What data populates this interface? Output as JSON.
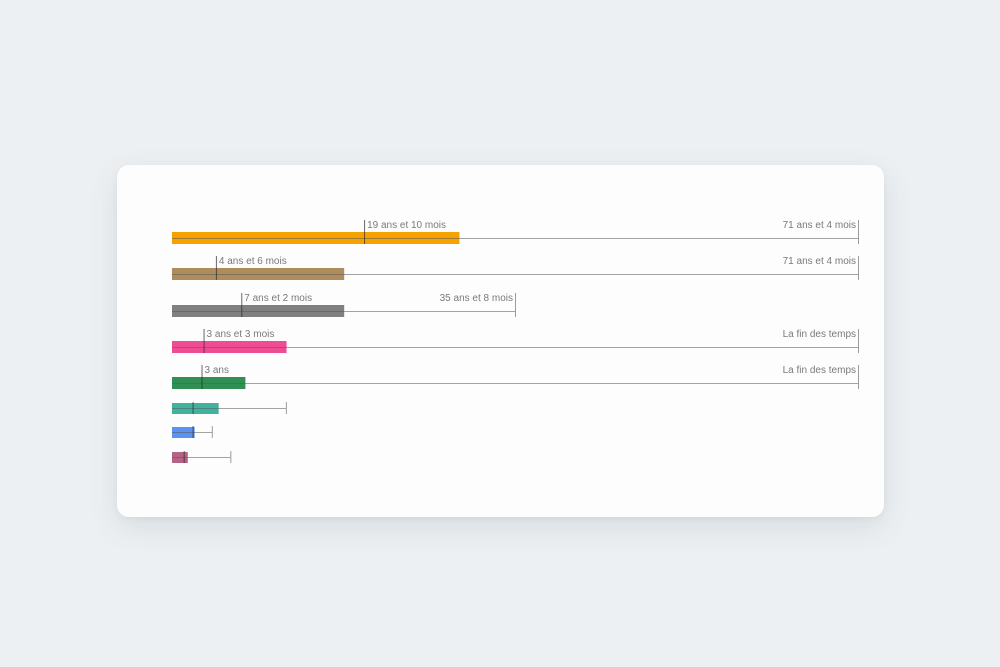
{
  "chart_data": {
    "type": "bar",
    "scale_max": 2000,
    "rows": [
      {
        "bar_value": 419,
        "bar_color": "#f5a100",
        "tick_value": 280,
        "tick_label": "19 ans et 10 mois",
        "range_end": 1000,
        "end_label": "71 ans et 4 mois"
      },
      {
        "bar_value": 251,
        "bar_color": "#ae8c5c",
        "tick_value": 64,
        "tick_label": "4 ans et 6 mois",
        "range_end": 1000,
        "end_label": "71 ans et 4 mois"
      },
      {
        "bar_value": 251,
        "bar_color": "#808080",
        "tick_value": 101,
        "tick_label": "7 ans et 2 mois",
        "range_end": 500,
        "end_label": "35 ans et 8 mois"
      },
      {
        "bar_value": 167,
        "bar_color": "#ef4d93",
        "tick_value": 46,
        "tick_label": "3 ans et 3 mois",
        "range_end": 1000,
        "end_label": "La fin des temps"
      },
      {
        "bar_value": 107,
        "bar_color": "#2f8f55",
        "tick_value": 43,
        "tick_label": "3 ans",
        "range_end": 1000,
        "end_label": "La fin des temps"
      },
      {
        "bar_value": 68,
        "bar_color": "#2bab95",
        "tick_value": 30,
        "tick_label": "",
        "range_end": 166,
        "end_label": ""
      },
      {
        "bar_value": 33,
        "bar_color": "#4a86ee",
        "tick_value": 30,
        "tick_label": "",
        "range_end": 58,
        "end_label": ""
      },
      {
        "bar_value": 23,
        "bar_color": "#ad5277",
        "tick_value": 17,
        "tick_label": "",
        "range_end": 85,
        "end_label": ""
      }
    ]
  }
}
